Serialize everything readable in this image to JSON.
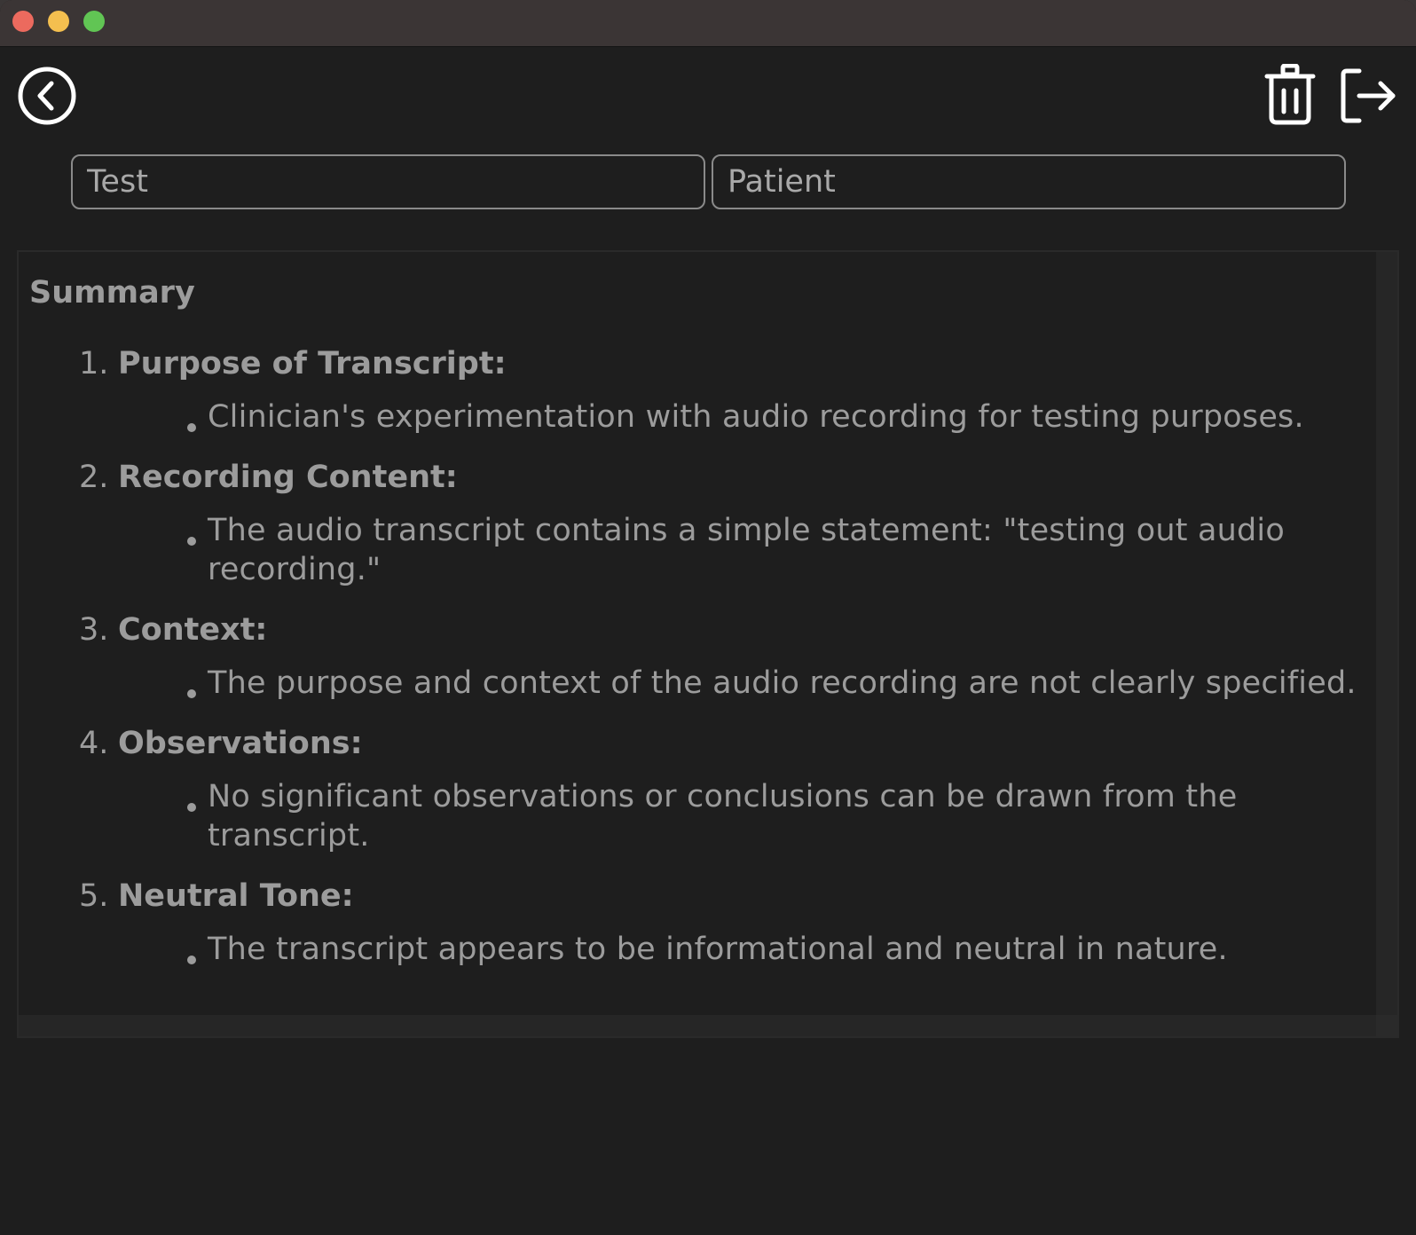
{
  "window": {
    "traffic_lights": {
      "close_color": "#ec6a5e",
      "minimize_color": "#f4bf4f",
      "maximize_color": "#61c554"
    }
  },
  "toolbar": {
    "back_icon": "chevron-left-circle-icon",
    "delete_icon": "trash-icon",
    "logout_icon": "logout-icon"
  },
  "fields": {
    "test_value": "Test",
    "patient_value": "Patient"
  },
  "summary": {
    "heading": "Summary",
    "items": [
      {
        "number": "1.",
        "title": "Purpose of Transcript:",
        "bullet": "Clinician's experimentation with audio recording for testing purposes."
      },
      {
        "number": "2.",
        "title": "Recording Content:",
        "bullet": "The audio transcript contains a simple statement: \"testing out audio recording.\""
      },
      {
        "number": "3.",
        "title": "Context:",
        "bullet": "The purpose and context of the audio recording are not clearly specified."
      },
      {
        "number": "4.",
        "title": "Observations:",
        "bullet": "No significant observations or conclusions can be drawn from the transcript."
      },
      {
        "number": "5.",
        "title": "Neutral Tone:",
        "bullet": "The transcript appears to be informational and neutral in nature."
      }
    ]
  }
}
